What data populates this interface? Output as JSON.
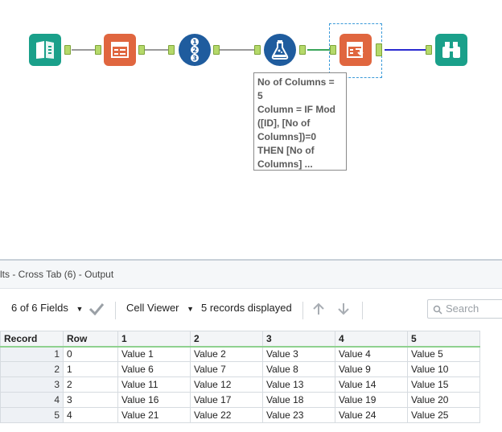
{
  "annotation": "No of Columns =\n5\nColumn = IF Mod\n([ID], [No of\nColumns])=0\nTHEN [No of\nColumns] ...",
  "panel": {
    "title": "lts - Cross Tab (6) - Output",
    "fields_label": "6 of 6 Fields",
    "cell_viewer_label": "Cell Viewer",
    "records_label": "5 records displayed",
    "search_placeholder": "Search"
  },
  "table": {
    "headers": [
      "Record",
      "Row",
      "1",
      "2",
      "3",
      "4",
      "5"
    ],
    "rows": [
      [
        "1",
        "0",
        "Value 1",
        "Value 2",
        "Value 3",
        "Value 4",
        "Value 5"
      ],
      [
        "2",
        "1",
        "Value 6",
        "Value 7",
        "Value 8",
        "Value 9",
        "Value 10"
      ],
      [
        "3",
        "2",
        "Value 11",
        "Value 12",
        "Value 13",
        "Value 14",
        "Value 15"
      ],
      [
        "4",
        "3",
        "Value 16",
        "Value 17",
        "Value 18",
        "Value 19",
        "Value 20"
      ],
      [
        "5",
        "4",
        "Value 21",
        "Value 22",
        "Value 23",
        "Value 24",
        "Value 25"
      ]
    ]
  },
  "colors": {
    "input_tool": "#1aa08a",
    "select_tool": "#e0663f",
    "record_id_tool": "#1f5c9e",
    "formula_tool": "#1f5c9e",
    "crosstab_tool": "#e0663f",
    "browse_tool": "#1aa08a",
    "anchor": "#b5d96a",
    "connector": "#9a9a9a",
    "output_connector": "#2b2bd0"
  },
  "icons": [
    "book-icon",
    "select-icon",
    "record-id-icon",
    "flask-icon",
    "crosstab-icon",
    "binoculars-icon",
    "checkmark-icon",
    "arrow-up-icon",
    "arrow-down-icon",
    "search-icon"
  ]
}
